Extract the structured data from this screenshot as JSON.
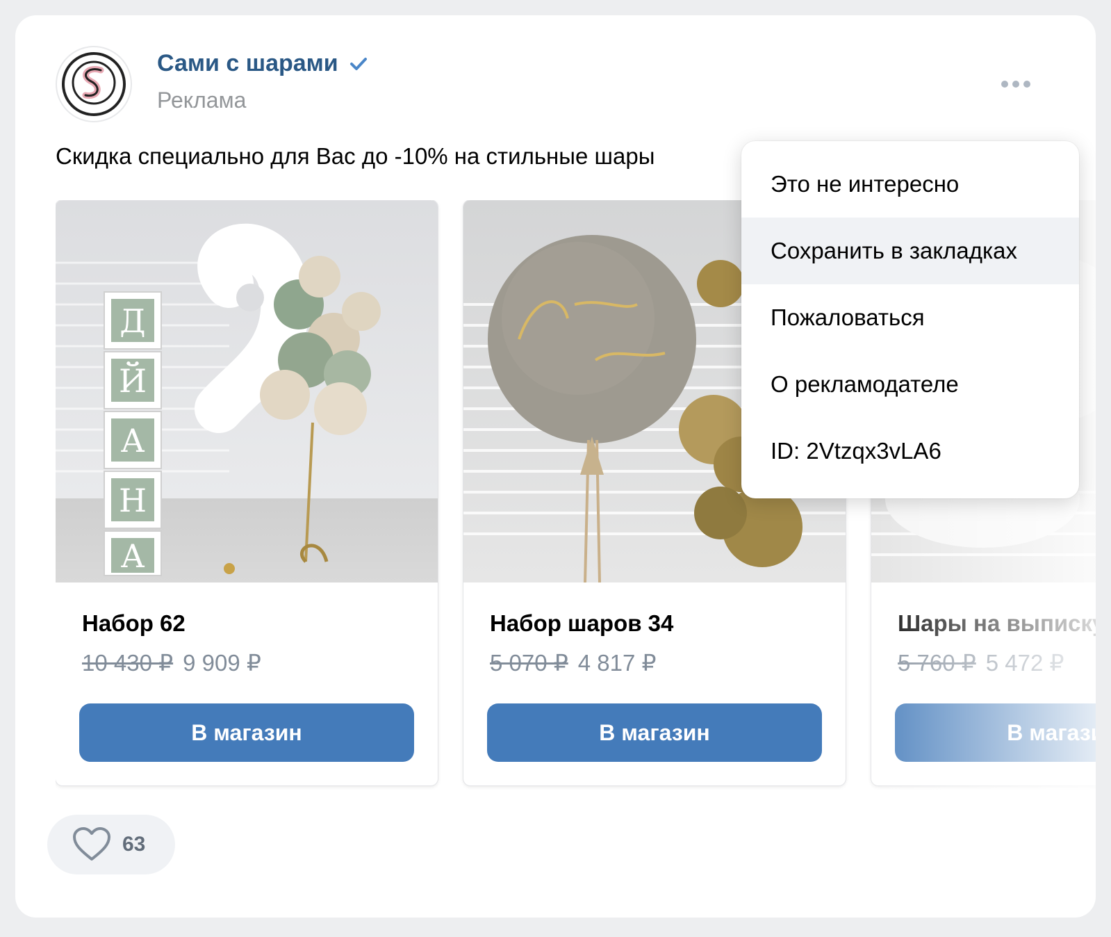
{
  "author": {
    "name": "Сами с шарами",
    "subtitle": "Реклама"
  },
  "post": {
    "text": "Скидка специально для Вас до -10% на стильные шары"
  },
  "cards": [
    {
      "title": "Набор 62",
      "old_price": "10 430 ₽",
      "price": "9 909 ₽",
      "button": "В магазин"
    },
    {
      "title": "Набор шаров 34",
      "old_price": "5 070 ₽",
      "price": "4 817 ₽",
      "button": "В магазин"
    },
    {
      "title": "Шары на выписку",
      "old_price": "5 760 ₽",
      "price": "5 472 ₽",
      "button": "В магазин"
    }
  ],
  "likes": {
    "count": "63"
  },
  "menu": {
    "items": [
      {
        "label": "Это не интересно"
      },
      {
        "label": "Сохранить в закладках"
      },
      {
        "label": "Пожаловаться"
      },
      {
        "label": "О рекламодателе"
      },
      {
        "label": "ID: 2Vtzqx3vLA6"
      }
    ]
  },
  "colors": {
    "brand_link": "#2a5885",
    "button": "#447bba",
    "muted": "#818c99",
    "background": "#edeef0"
  }
}
